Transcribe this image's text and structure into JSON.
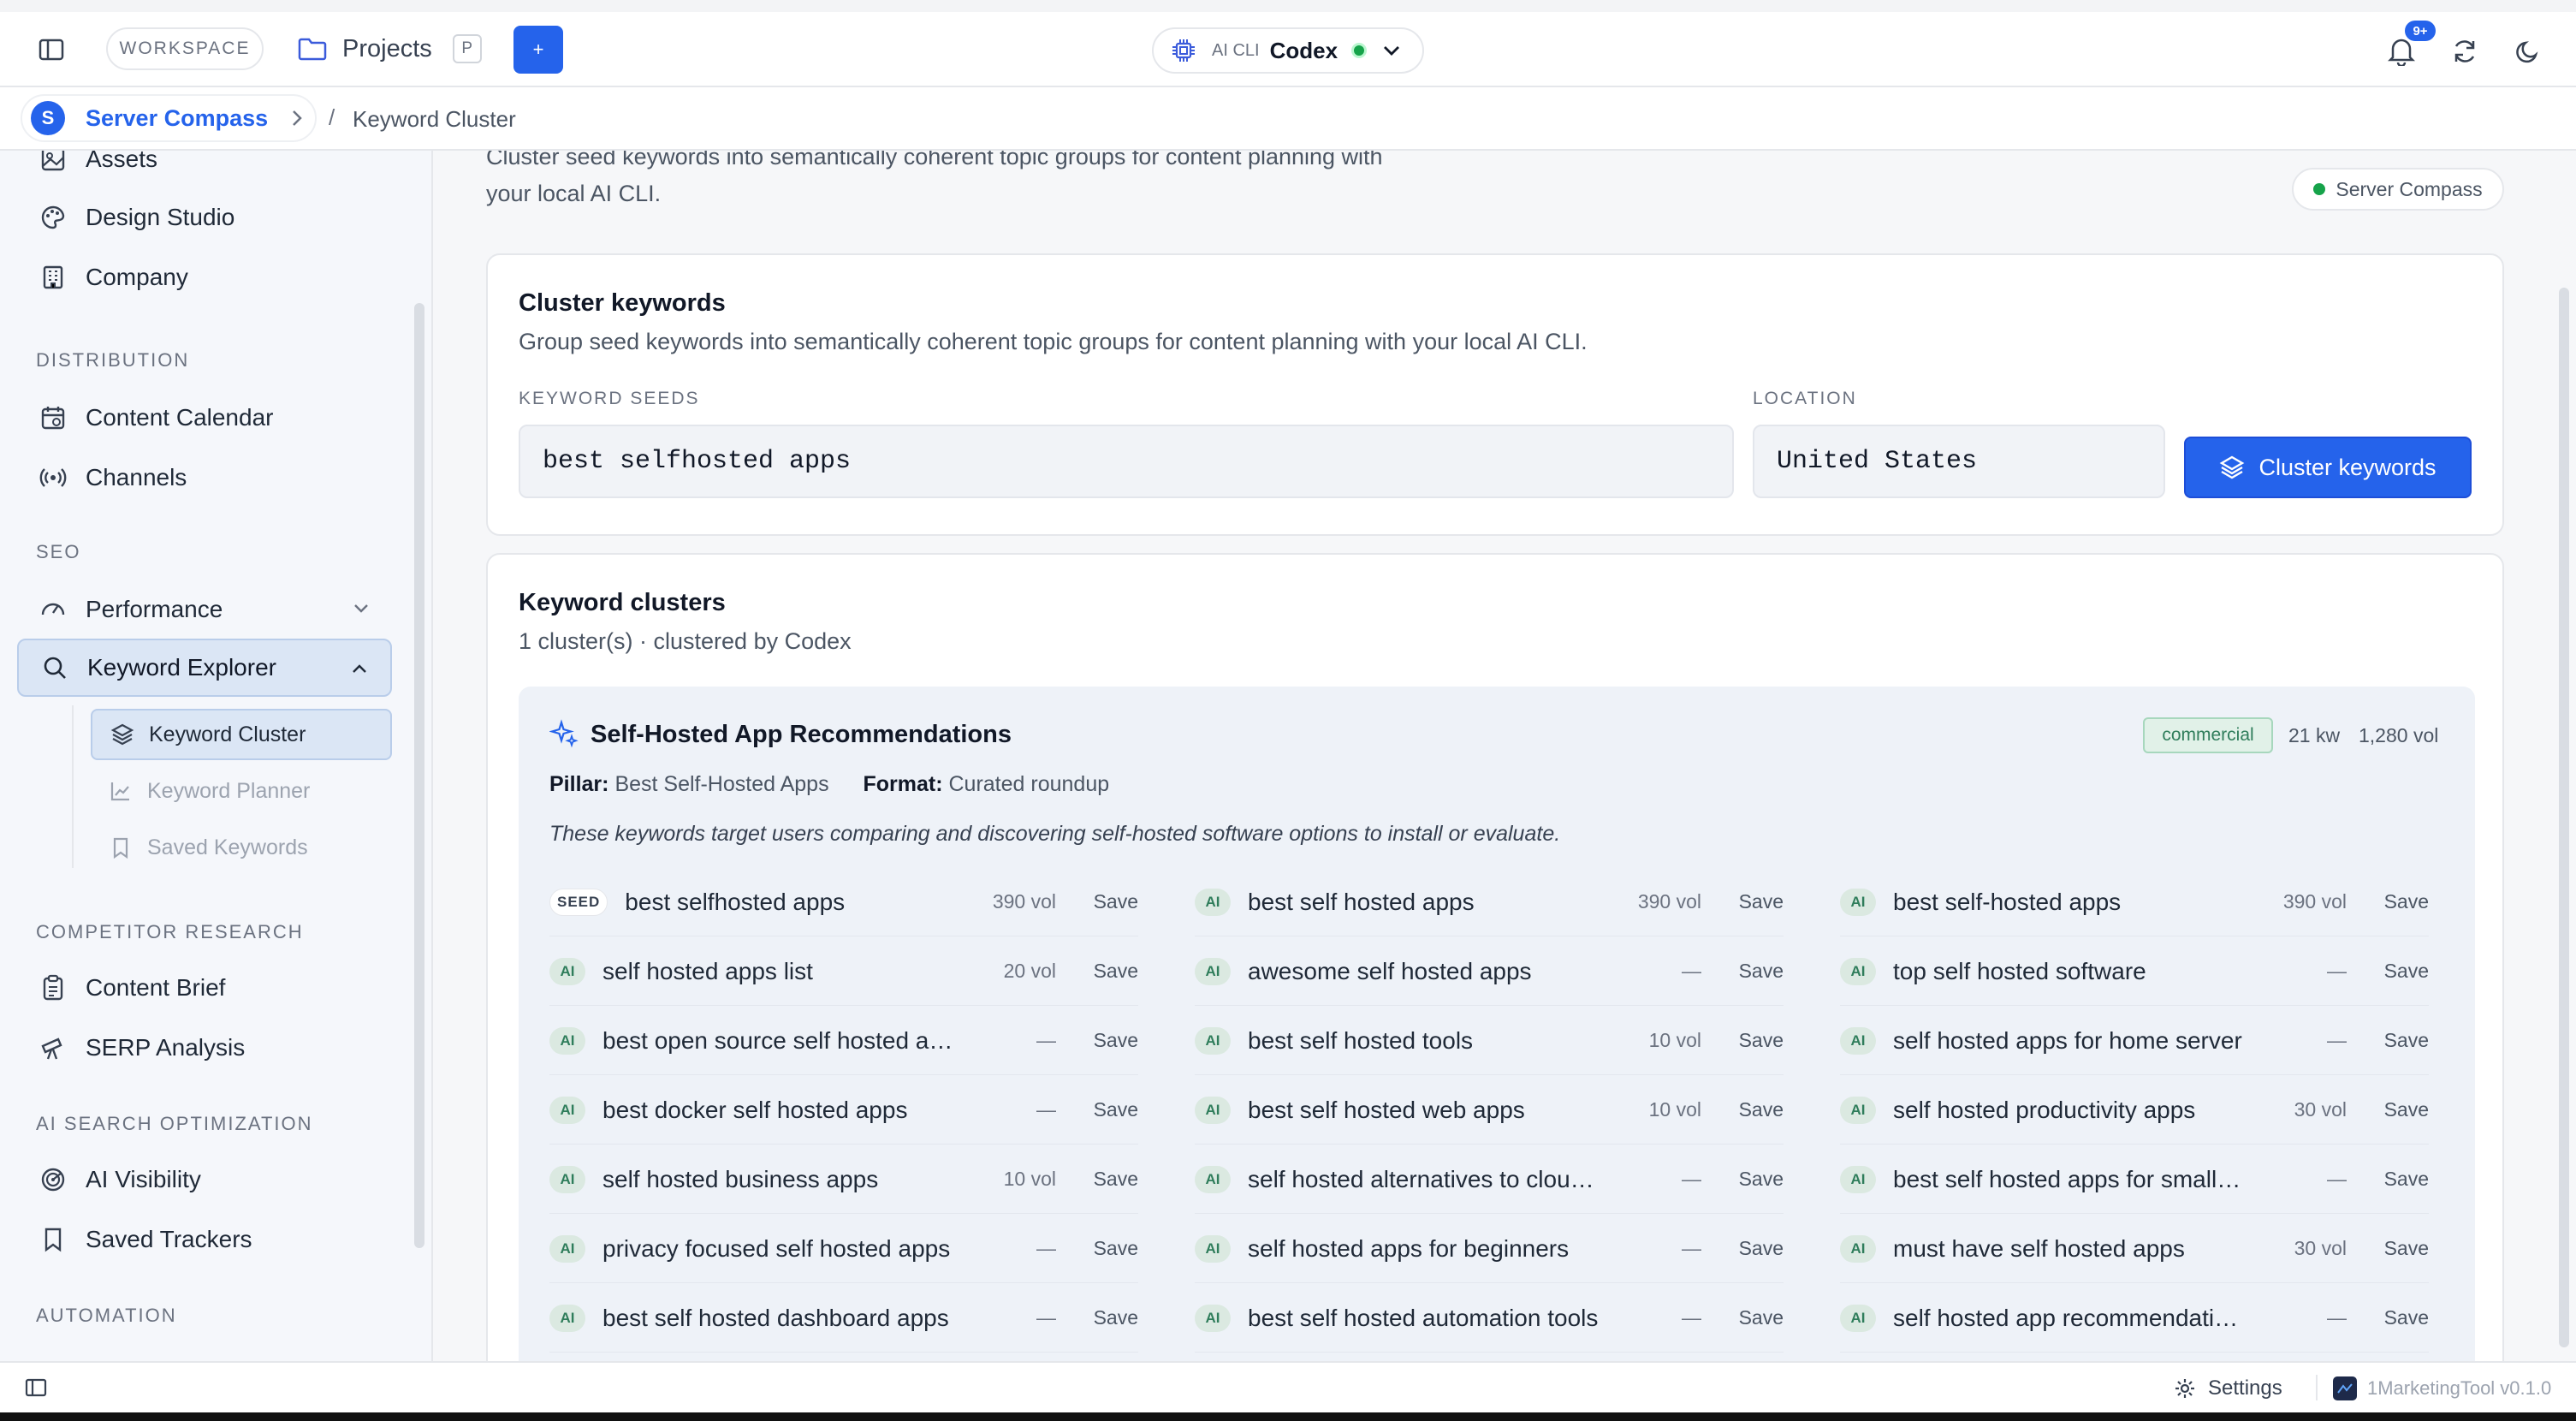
{
  "topbar": {
    "workspace_label": "WORKSPACE",
    "projects_label": "Projects",
    "projects_shortcut": "P",
    "add_label": "+",
    "ai_cli_label": "AI CLI",
    "ai_cli_name": "Codex",
    "notification_badge": "9+"
  },
  "breadcrumb": {
    "project_avatar": "S",
    "project_name": "Server Compass",
    "separator": "/",
    "current": "Keyword Cluster"
  },
  "sidebar": {
    "top_items": [
      {
        "label": "Assets",
        "icon": "image-icon"
      },
      {
        "label": "Design Studio",
        "icon": "palette-icon"
      },
      {
        "label": "Company",
        "icon": "building-icon"
      }
    ],
    "sections": {
      "distribution": "DISTRIBUTION",
      "seo": "SEO",
      "competitor": "COMPETITOR RESEARCH",
      "ai_search": "AI SEARCH OPTIMIZATION",
      "automation": "AUTOMATION"
    },
    "distribution_items": [
      {
        "label": "Content Calendar",
        "icon": "calendar-icon"
      },
      {
        "label": "Channels",
        "icon": "broadcast-icon"
      }
    ],
    "seo_items": [
      {
        "label": "Performance",
        "icon": "gauge-icon"
      },
      {
        "label": "Keyword Explorer",
        "icon": "search-icon"
      }
    ],
    "keyword_sub_items": [
      {
        "label": "Keyword Cluster",
        "icon": "layers-icon"
      },
      {
        "label": "Keyword Planner",
        "icon": "chart-line-icon"
      },
      {
        "label": "Saved Keywords",
        "icon": "bookmark-icon"
      }
    ],
    "competitor_items": [
      {
        "label": "Content Brief",
        "icon": "clipboard-icon"
      },
      {
        "label": "SERP Analysis",
        "icon": "telescope-icon"
      }
    ],
    "ai_items": [
      {
        "label": "AI Visibility",
        "icon": "radar-icon"
      },
      {
        "label": "Saved Trackers",
        "icon": "bookmark-icon"
      }
    ]
  },
  "page": {
    "intro": "Cluster seed keywords into semantically coherent topic groups for content planning with your local AI CLI.",
    "project_badge": "Server Compass"
  },
  "cluster_form": {
    "title": "Cluster keywords",
    "description": "Group seed keywords into semantically coherent topic groups for content planning with your local AI CLI.",
    "seeds_label": "KEYWORD SEEDS",
    "seeds_value": "best selfhosted apps",
    "location_label": "LOCATION",
    "location_value": "United States",
    "submit_label": "Cluster keywords"
  },
  "clusters": {
    "title": "Keyword clusters",
    "subtitle": "1 cluster(s) · clustered by Codex",
    "cluster": {
      "name": "Self-Hosted App Recommendations",
      "intent": "commercial",
      "kw_count": "21 kw",
      "volume": "1,280 vol",
      "pillar_label": "Pillar:",
      "pillar_value": "Best Self-Hosted Apps",
      "format_label": "Format:",
      "format_value": "Curated roundup",
      "summary": "These keywords target users comparing and discovering self-hosted software options to install or evaluate.",
      "save_label": "Save",
      "keywords": [
        {
          "tag": "SEED",
          "text": "best selfhosted apps",
          "vol": "390 vol"
        },
        {
          "tag": "AI",
          "text": "best self hosted apps",
          "vol": "390 vol"
        },
        {
          "tag": "AI",
          "text": "best self-hosted apps",
          "vol": "390 vol"
        },
        {
          "tag": "AI",
          "text": "self hosted apps list",
          "vol": "20 vol"
        },
        {
          "tag": "AI",
          "text": "awesome self hosted apps",
          "vol": "—"
        },
        {
          "tag": "AI",
          "text": "top self hosted software",
          "vol": "—"
        },
        {
          "tag": "AI",
          "text": "best open source self hosted apps",
          "vol": "—"
        },
        {
          "tag": "AI",
          "text": "best self hosted tools",
          "vol": "10 vol"
        },
        {
          "tag": "AI",
          "text": "self hosted apps for home server",
          "vol": "—"
        },
        {
          "tag": "AI",
          "text": "best docker self hosted apps",
          "vol": "—"
        },
        {
          "tag": "AI",
          "text": "best self hosted web apps",
          "vol": "10 vol"
        },
        {
          "tag": "AI",
          "text": "self hosted productivity apps",
          "vol": "30 vol"
        },
        {
          "tag": "AI",
          "text": "self hosted business apps",
          "vol": "10 vol"
        },
        {
          "tag": "AI",
          "text": "self hosted alternatives to cloud apps",
          "vol": "—"
        },
        {
          "tag": "AI",
          "text": "best self hosted apps for small busi...",
          "vol": "—"
        },
        {
          "tag": "AI",
          "text": "privacy focused self hosted apps",
          "vol": "—"
        },
        {
          "tag": "AI",
          "text": "self hosted apps for beginners",
          "vol": "—"
        },
        {
          "tag": "AI",
          "text": "must have self hosted apps",
          "vol": "30 vol"
        },
        {
          "tag": "AI",
          "text": "best self hosted dashboard apps",
          "vol": "—"
        },
        {
          "tag": "AI",
          "text": "best self hosted automation tools",
          "vol": "—"
        },
        {
          "tag": "AI",
          "text": "self hosted app recommendations",
          "vol": "—"
        }
      ]
    }
  },
  "bottombar": {
    "settings_label": "Settings",
    "app_version": "1MarketingTool v0.1.0"
  },
  "colors": {
    "accent": "#2563eb",
    "selected_bg": "#dbe6f5",
    "status_green": "#16a34a"
  }
}
